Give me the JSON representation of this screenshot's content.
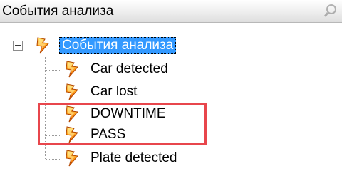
{
  "panel": {
    "title": "События анализа",
    "icon": "search-icon"
  },
  "tree": {
    "root": {
      "label": "События анализа",
      "selected": true,
      "expanded": true,
      "icon": "lightning-event-icon"
    },
    "children": [
      {
        "label": "Car detected",
        "icon": "lightning-event-icon"
      },
      {
        "label": "Car lost",
        "icon": "lightning-event-icon"
      },
      {
        "label": "DOWNTIME",
        "icon": "lightning-event-icon"
      },
      {
        "label": "PASS",
        "icon": "lightning-event-icon"
      },
      {
        "label": "Plate detected",
        "icon": "lightning-event-icon"
      }
    ]
  },
  "annotation": {
    "color": "#e8464c",
    "highlighted_items": [
      "DOWNTIME",
      "PASS"
    ]
  },
  "colors": {
    "selection": "#3399ff",
    "icon_orange": "#ff8a00",
    "icon_yellow": "#ffd54a"
  }
}
